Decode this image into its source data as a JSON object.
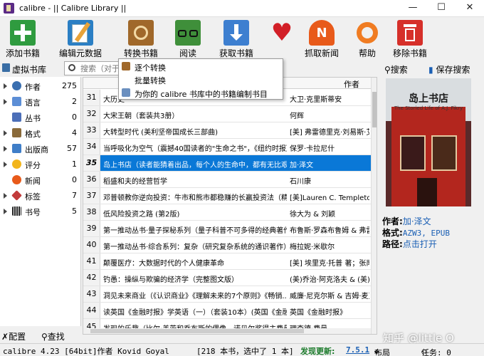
{
  "window": {
    "title": "calibre - || Calibre Library ||",
    "minimize": "—",
    "maximize": "☐",
    "close": "✕"
  },
  "toolbar": {
    "add": "添加书籍",
    "edit_meta": "编辑元数据",
    "convert": "转换书籍",
    "read": "阅读",
    "fetch": "获取书籍",
    "fetch_news": "抓取新闻",
    "help": "帮助",
    "remove": "移除书籍"
  },
  "bar2": {
    "virtual_library": "虚拟书库",
    "search_placeholder": "搜索（对于",
    "search_button": "搜索",
    "save_search": "保存搜索"
  },
  "convert_menu": {
    "items": [
      "逐个转换",
      "批量转换",
      "为你的 calibre 书库中的书籍编制书目"
    ]
  },
  "tag_browser": {
    "items": [
      {
        "label": "作者",
        "count": "275"
      },
      {
        "label": "语言",
        "count": "2"
      },
      {
        "label": "丛书",
        "count": "0"
      },
      {
        "label": "格式",
        "count": "4"
      },
      {
        "label": "出版商",
        "count": "57"
      },
      {
        "label": "评分",
        "count": "1"
      },
      {
        "label": "新闻",
        "count": "0"
      },
      {
        "label": "标签",
        "count": "7"
      },
      {
        "label": "书号",
        "count": "5"
      }
    ],
    "configure": "配置",
    "find": "查找"
  },
  "book_list": {
    "header_author": "作者",
    "rows": [
      {
        "num": "31",
        "title": "大历史",
        "author": "大卫·克里斯蒂安"
      },
      {
        "num": "32",
        "title": "大宋王朝（套装共3册）",
        "author": "何辉"
      },
      {
        "num": "33",
        "title": "大转型时代 (美利坚帝国成长三部曲)",
        "author": "[美] 弗雷德里克·刘易斯·艾伦"
      },
      {
        "num": "34",
        "title": "当呼吸化为空气（震撼40国读者的\"生命之书\"，《纽约时报》...",
        "author": "保罗·卡拉尼什"
      },
      {
        "num": "35",
        "title": "岛上书店（读者能猜着出品，每个人的生命中，都有无比艰难的那...",
        "author": "加·泽文"
      },
      {
        "num": "36",
        "title": "稻盛和夫的经营哲学",
        "author": "石川康"
      },
      {
        "num": "37",
        "title": "邓普顿教你逆向投资：牛市和熊市都稳赚的长赢投资法（精编...",
        "author": "[美]Lauren C. Templeton"
      },
      {
        "num": "38",
        "title": "低风险投资之路 (第2版)",
        "author": "徐大为 & 刘颖"
      },
      {
        "num": "39",
        "title": "第一推动丛书·量子探秘系列（量子科普不可多得的经典著作...",
        "author": "布鲁斯·罗森布鲁姆 & 弗雷德"
      },
      {
        "num": "40",
        "title": "第一推动丛书·综合系列：复杂（研究复杂系统的通识著作）",
        "author": "梅拉妮·米歇尔"
      },
      {
        "num": "41",
        "title": "颠覆医疗：大数据时代的个人健康革命",
        "author": "[美] 埃里克·托普 著；张南"
      },
      {
        "num": "42",
        "title": "钓愚：操纵与欺骗的经济学（完整图文版）",
        "author": "(美)乔治·阿克洛夫 & (美)罗伯特"
      },
      {
        "num": "43",
        "title": "洞见未来商业（《认识商业》《理解未来的7个原则》《畅销...",
        "author": "威廉·尼克尔斯 & 吉姆·麦克"
      },
      {
        "num": "44",
        "title": "读英国《金融时报》学英语（一）（套装10本）(英国《金融...",
        "author": "英国《金融时报》"
      },
      {
        "num": "45",
        "title": "发现的乐趣（比尔·盖茨和乔布斯的偶像、诺贝尔奖得主费曼...",
        "author": "理查德·费曼"
      }
    ]
  },
  "details": {
    "cover_title": "岛上书店",
    "cover_sub": "The Storied Life of A.J. Fikry",
    "author_key": "作者:",
    "author_val": "加·泽文",
    "format_key": "格式:",
    "format_val": "AZW3, EPUB",
    "path_key": "路径:",
    "path_val": "点击打开"
  },
  "watermark": "知乎 @little O",
  "status": {
    "left": "calibre 4.23 [64bit]作者 Kovid Goyal",
    "count": "[218 本书，选中了 1 本]",
    "update_label": "发现更新:",
    "update_version": "7.5.1",
    "layout": "布局",
    "tasks": "任务: 0"
  },
  "colors": {
    "selection": "#0a78d7",
    "link": "#1a5fb4",
    "update": "#1a7a2a"
  }
}
